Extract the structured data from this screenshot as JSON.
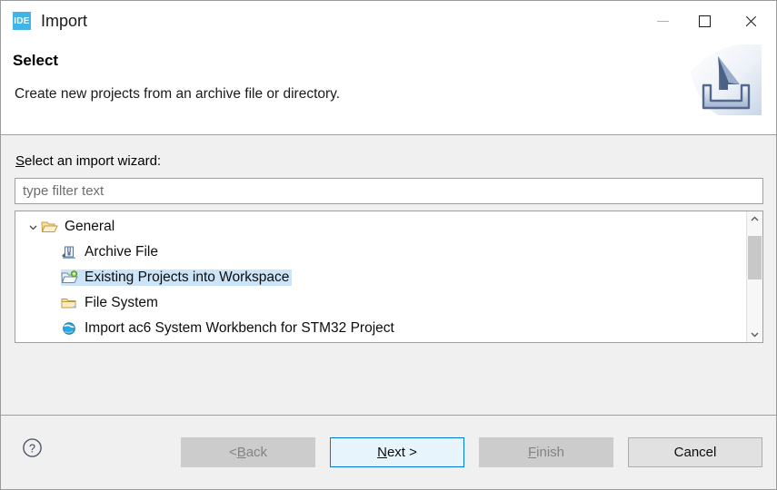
{
  "window": {
    "app_icon_text": "IDE",
    "title": "Import",
    "controls": {
      "minimize": "minimize-button",
      "maximize": "maximize-button",
      "close": "close-button"
    }
  },
  "header": {
    "title": "Select",
    "description": "Create new projects from an archive file or directory.",
    "banner_icon": "import-banner-icon"
  },
  "form": {
    "wizard_label_mnemonic": "S",
    "wizard_label_rest": "elect an import wizard:",
    "filter_placeholder": "type filter text",
    "filter_value": ""
  },
  "tree": {
    "items": [
      {
        "label": "General",
        "level": 0,
        "expanded": true,
        "twisty": "⌄",
        "icon": "open-folder-icon",
        "selected": false
      },
      {
        "label": "Archive File",
        "level": 1,
        "icon": "archive-file-icon",
        "selected": false
      },
      {
        "label": "Existing Projects into Workspace",
        "level": 1,
        "icon": "import-project-folder-icon",
        "selected": true
      },
      {
        "label": "File System",
        "level": 1,
        "icon": "folder-icon",
        "selected": false
      },
      {
        "label": "Import ac6 System Workbench for STM32 Project",
        "level": 1,
        "icon": "globe-icon",
        "selected": false
      }
    ],
    "selection_color": "#cce4f7",
    "scrollbar": {
      "up_arrow": "⌃",
      "down_arrow": "⌄",
      "thumb_position": "near-top"
    }
  },
  "footer": {
    "help_icon": "help-icon",
    "buttons": [
      {
        "name": "back-button",
        "prefix": "< ",
        "mnemonic": "B",
        "suffix": "ack",
        "state": "disabled"
      },
      {
        "name": "next-button",
        "prefix": "",
        "mnemonic": "N",
        "suffix": "ext >",
        "state": "default"
      },
      {
        "name": "finish-button",
        "prefix": "",
        "mnemonic": "F",
        "suffix": "inish",
        "state": "disabled"
      },
      {
        "name": "cancel-button",
        "prefix": "",
        "mnemonic": "",
        "suffix": "Cancel",
        "state": "enabled"
      }
    ]
  },
  "colors": {
    "accent": "#0078d7",
    "app_icon_bg": "#41b6e6",
    "selection": "#cce4f7",
    "window_bg": "#f0f0f0"
  }
}
